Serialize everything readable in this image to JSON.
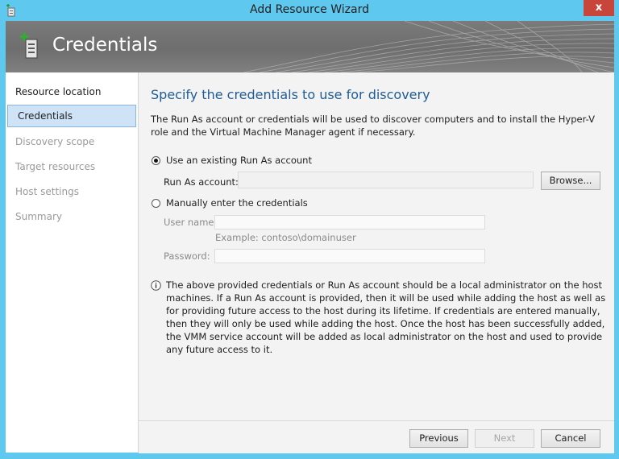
{
  "window": {
    "title": "Add Resource Wizard",
    "close_glyph": "x"
  },
  "banner": {
    "title": "Credentials"
  },
  "nav": {
    "items": [
      {
        "label": "Resource location"
      },
      {
        "label": "Credentials"
      },
      {
        "label": "Discovery scope"
      },
      {
        "label": "Target resources"
      },
      {
        "label": "Host settings"
      },
      {
        "label": "Summary"
      }
    ]
  },
  "main": {
    "heading": "Specify the credentials to use for discovery",
    "intro": "The Run As account or credentials will be used to discover computers and to install the Hyper-V role and the Virtual Machine Manager agent if necessary.",
    "option_runas": {
      "label": "Use an existing Run As account",
      "selected": true,
      "field_label": "Run As account:",
      "value": "",
      "browse_label": "Browse..."
    },
    "option_manual": {
      "label": "Manually enter the credentials",
      "selected": false,
      "username_label": "User name:",
      "username_value": "",
      "username_example": "Example: contoso\\domainuser",
      "password_label": "Password:",
      "password_value": ""
    },
    "info": "The above provided credentials or Run As account should be a local administrator on the host machines. If a Run As account is provided, then it will be used while adding the host as well as for providing future access to the host during its lifetime. If credentials are entered manually, then they will only be used while adding the host. Once the host has been successfully added, the VMM service account will be added as local administrator on the host and used to provide any future access to it."
  },
  "footer": {
    "previous_label": "Previous",
    "next_label": "Next",
    "cancel_label": "Cancel"
  },
  "colors": {
    "window_frame": "#5ec8ef",
    "heading": "#1f5c96",
    "nav_active": "#cfe3f6",
    "close": "#c7453a"
  }
}
